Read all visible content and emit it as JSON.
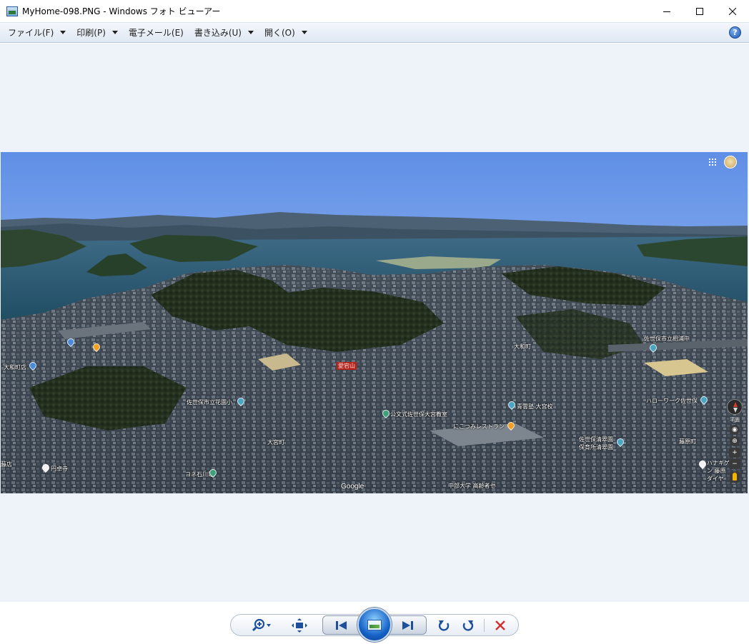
{
  "window": {
    "title": "MyHome-098.PNG - Windows フォト ビューアー",
    "icon": "photo-viewer-app-icon",
    "controls": [
      "minimize-icon",
      "maximize-icon",
      "close-icon"
    ]
  },
  "menubar": {
    "items": [
      {
        "label": "ファイル(F)",
        "has_dropdown": true
      },
      {
        "label": "印刷(P)",
        "has_dropdown": true
      },
      {
        "label": "電子メール(E)",
        "has_dropdown": false
      },
      {
        "label": "書き込み(U)",
        "has_dropdown": true
      },
      {
        "label": "開く(O)",
        "has_dropdown": true
      }
    ],
    "help_label": "?"
  },
  "photo": {
    "description_icon": "aerial-map-image",
    "map_labels": {
      "hospital": "大和町店",
      "temple": "円卓寺",
      "school1": "佐世保市立花園小",
      "town1": "大宮町",
      "kinder": "公文式佐世保大宮教室",
      "town2": "大和町",
      "school2": "佐世保市立相浦中",
      "ramen": "にこつみレストラン",
      "school3": "青雲塾 大宮校",
      "nursery": "佐世保清翠園 保育所清翠園",
      "hellowork": "ハローワーク佐世保",
      "town3": "藤原町",
      "shop": "ヨネ石川電",
      "station": "愛宕山",
      "hall": "中部大学 高齢者セ",
      "left_edge": "藤店",
      "right_store": "ハナキゲン 藤原ダイヤ"
    },
    "google_watermark": "Google",
    "flat_label": "平面",
    "zoom_in": "+",
    "zoom_out": "−"
  },
  "toolbar": {
    "buttons": [
      "zoom-icon",
      "fit-to-window-icon",
      "previous-icon",
      "slideshow-icon",
      "next-icon",
      "rotate-counterclockwise-icon",
      "rotate-clockwise-icon",
      "delete-icon"
    ]
  },
  "colors": {
    "viewer_background": "#eef2f9",
    "menubar_top": "#f4f7fc",
    "menubar_bottom": "#dfe8f3",
    "accent_blue": "#1663c7",
    "delete_red": "#d0312d"
  }
}
